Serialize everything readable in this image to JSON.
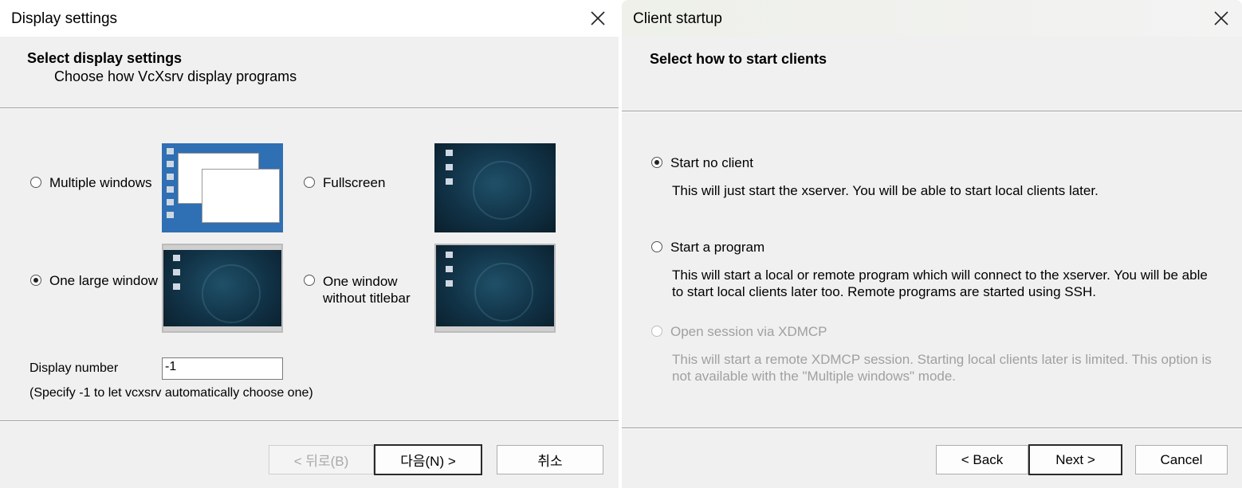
{
  "display_settings": {
    "title": "Display settings",
    "heading": "Select display settings",
    "subheading": "Choose how VcXsrv display programs",
    "options": {
      "multiple_windows": {
        "label": "Multiple windows",
        "checked": false
      },
      "fullscreen": {
        "label": "Fullscreen",
        "checked": false
      },
      "one_large_window": {
        "label": "One large window",
        "checked": true
      },
      "one_window_no_titlebar": {
        "label_line1": "One window",
        "label_line2": "without titlebar",
        "checked": false
      }
    },
    "display_number_label": "Display number",
    "display_number_value": "-1",
    "display_number_hint": "(Specify -1 to let vcxsrv automatically choose one)",
    "buttons": {
      "back": "< 뒤로(B)",
      "next": "다음(N) >",
      "cancel": "취소"
    }
  },
  "client_startup": {
    "title": "Client startup",
    "heading": "Select how to start clients",
    "options": {
      "no_client": {
        "label": "Start no client",
        "checked": true,
        "description": [
          "This will just start the xserver. You will be able to start local clients later."
        ]
      },
      "program": {
        "label": "Start a program",
        "checked": false,
        "description": [
          "This will start a local or remote program which will connect to the xserver. You will be able",
          "to start local clients later too. Remote programs are started using SSH."
        ]
      },
      "xdmcp": {
        "label": "Open session via XDMCP",
        "checked": false,
        "disabled": true,
        "description": [
          "This will start a remote XDMCP session. Starting local clients later is limited. This option is",
          "not available with the \"Multiple windows\" mode."
        ]
      }
    },
    "buttons": {
      "back": "< Back",
      "next": "Next >",
      "cancel": "Cancel"
    }
  },
  "colors": {
    "dialog_bg": "#f0f0f0",
    "desktop_blue": "#2f6fb3",
    "debian_dark": "#113246",
    "disabled_text": "#a0a0a0"
  },
  "icons": [
    "close-icon",
    "radio-icon"
  ]
}
